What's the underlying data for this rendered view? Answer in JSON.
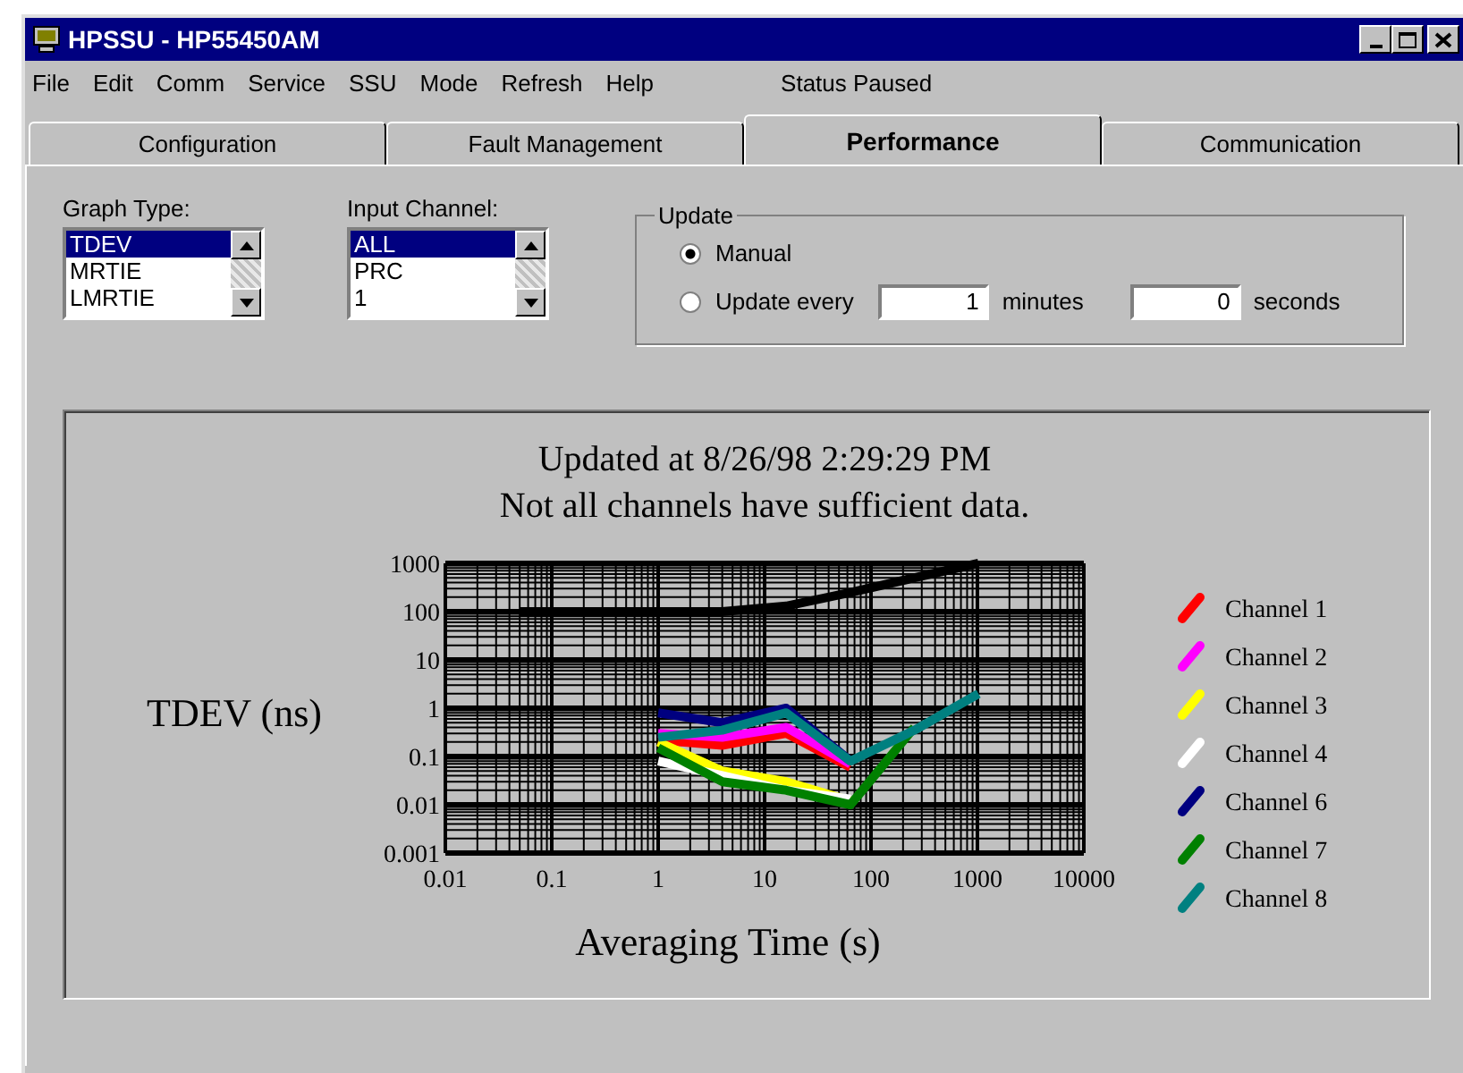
{
  "window": {
    "title": "HPSSU - HP55450AM"
  },
  "menu": [
    "File",
    "Edit",
    "Comm",
    "Service",
    "SSU",
    "Mode",
    "Refresh",
    "Help"
  ],
  "status": "Status Paused",
  "tabs": [
    {
      "label": "Configuration",
      "selected": false
    },
    {
      "label": "Fault Management",
      "selected": false
    },
    {
      "label": "Performance",
      "selected": true
    },
    {
      "label": "Communication",
      "selected": false
    }
  ],
  "graph_type": {
    "label": "Graph Type:",
    "items": [
      {
        "label": "TDEV",
        "selected": true
      },
      {
        "label": "MRTIE",
        "selected": false
      },
      {
        "label": "LMRTIE",
        "selected": false
      }
    ]
  },
  "input_channel": {
    "label": "Input Channel:",
    "items": [
      {
        "label": "ALL",
        "selected": true
      },
      {
        "label": "PRC",
        "selected": false
      },
      {
        "label": "1",
        "selected": false
      }
    ]
  },
  "update": {
    "label": "Update",
    "options": [
      {
        "label": "Manual",
        "selected": true
      },
      {
        "label": "Update every",
        "selected": false
      }
    ],
    "minutes": "1",
    "minutes_label": "minutes",
    "seconds": "0",
    "seconds_label": "seconds"
  },
  "chart_panel": {
    "title": "Updated at 8/26/98 2:29:29 PM",
    "note": "Not all channels have sufficient data.",
    "ylabel": "TDEV (ns)",
    "xlabel": "Averaging Time (s)",
    "y_tick_labels": [
      "1000",
      "100",
      "10",
      "1",
      "0.1",
      "0.01",
      "0.001"
    ],
    "x_tick_labels": [
      "0.01",
      "0.1",
      "1",
      "10",
      "100",
      "1000",
      "10000"
    ],
    "legend": [
      {
        "name": "Channel 1",
        "color": "#ff0000"
      },
      {
        "name": "Channel 2",
        "color": "#ff00ff"
      },
      {
        "name": "Channel 3",
        "color": "#ffff00"
      },
      {
        "name": "Channel 4",
        "color": "#ffffff"
      },
      {
        "name": "Channel 6",
        "color": "#000080"
      },
      {
        "name": "Channel 7",
        "color": "#008000"
      },
      {
        "name": "Channel 8",
        "color": "#008080"
      }
    ]
  }
}
